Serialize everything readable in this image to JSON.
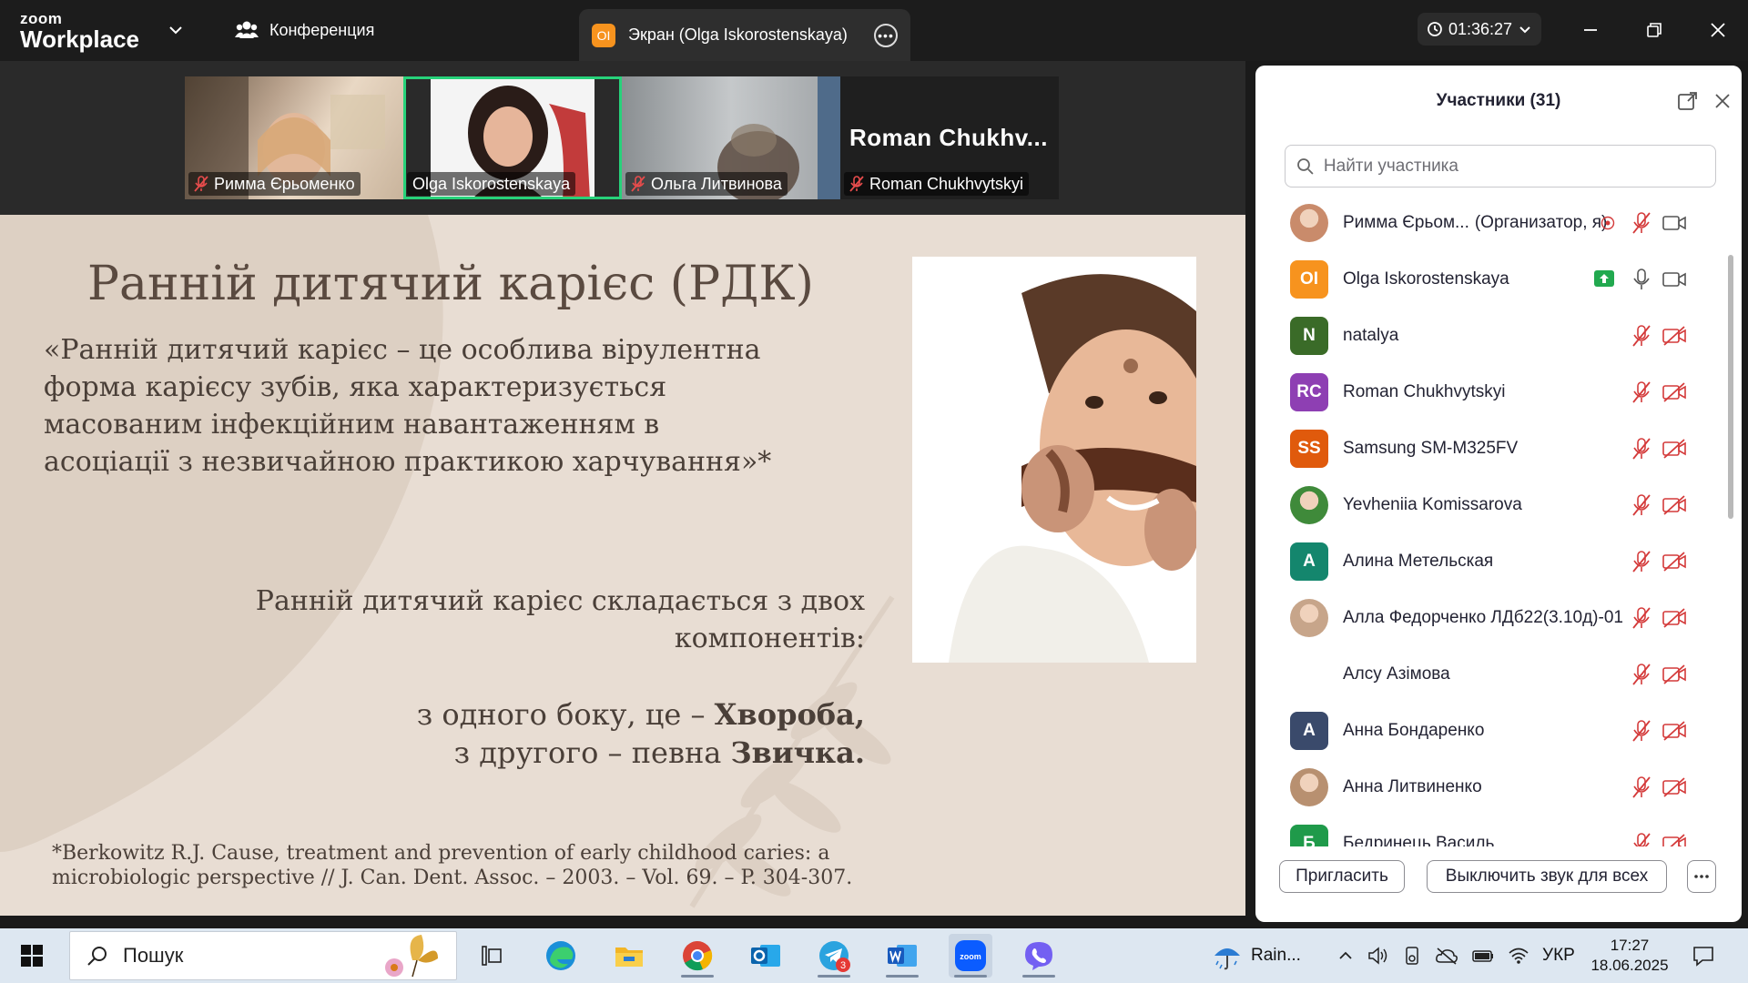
{
  "topbar": {
    "brand_small": "zoom",
    "brand_big": "Workplace",
    "conference_label": "Конференция",
    "screen_tab_badge": "OI",
    "screen_tab_label": "Экран (Olga Iskorostenskaya)",
    "timer": "01:36:27"
  },
  "video_strip": [
    {
      "name": "Римма Єрьоменко",
      "muted": true
    },
    {
      "name": "Olga Iskorostenskaya",
      "muted": false,
      "active": true
    },
    {
      "name": "Ольга Литвинова",
      "muted": true
    },
    {
      "name": "Roman Chukhvytskyi",
      "muted": true,
      "big_name": "Roman  Chukhv..."
    }
  ],
  "slide": {
    "title": "Ранній дитячий карієс (РДК)",
    "definition": "«Ранній дитячий карієс – це особлива вірулентна форма карієсу зубів, яка характеризується масованим інфекційним навантаженням в асоціації з незвичайною практикою харчування»*",
    "components": "Ранній дитячий карієс складається з двох компонентів:",
    "side1_prefix": "з одного боку, це – ",
    "side1_bold": "Хвороба,",
    "side2_prefix": "з другого – певна ",
    "side2_bold": "Звичка.",
    "reference": "*Berkowitz R.J. Cause, treatment and prevention of early childhood caries: a microbiologic perspective // J. Can. Dent. Assoc. – 2003. – Vol. 69. – P. 304-307."
  },
  "participants": {
    "title": "Участники (31)",
    "search_placeholder": "Найти участника",
    "list": [
      {
        "name": "Римма Єрьом...",
        "role": "(Организатор, я)",
        "avatar_type": "photo",
        "avatar_color": "#c98b6b",
        "mic": "muted",
        "video": "on",
        "extra": "record-icon"
      },
      {
        "name": "Olga Iskorostenskaya",
        "initials": "OI",
        "avatar_color": "#f7931e",
        "mic": "on",
        "video": "on",
        "extra": "share-icon"
      },
      {
        "name": "natalya",
        "initials": "N",
        "avatar_color": "#3a6b28",
        "mic": "muted",
        "video": "off"
      },
      {
        "name": "Roman Chukhvytskyi",
        "initials": "RC",
        "avatar_color": "#8e3fb3",
        "mic": "muted",
        "video": "off"
      },
      {
        "name": "Samsung SM-M325FV",
        "initials": "SS",
        "avatar_color": "#e05a0c",
        "mic": "muted",
        "video": "off"
      },
      {
        "name": "Yevheniia Komissarova",
        "avatar_type": "photo",
        "avatar_color": "#3f8a3a",
        "mic": "muted",
        "video": "off"
      },
      {
        "name": "Алина Метельская",
        "initials": "А",
        "avatar_color": "#14866d",
        "mic": "muted",
        "video": "off"
      },
      {
        "name": "Алла Федорченко ЛДб22(3.10д)-01",
        "avatar_type": "photo",
        "avatar_color": "#c7a58a",
        "mic": "muted",
        "video": "off"
      },
      {
        "name": "Алсу Азімова",
        "avatar_type": "none",
        "mic": "muted",
        "video": "off"
      },
      {
        "name": "Анна Бондаренко",
        "initials": "А",
        "avatar_color": "#3a4a6b",
        "mic": "muted",
        "video": "off"
      },
      {
        "name": "Анна Литвиненко",
        "avatar_type": "photo",
        "avatar_color": "#b89070",
        "mic": "muted",
        "video": "off"
      },
      {
        "name": "Бедринець Василь",
        "initials": "Б",
        "avatar_color": "#1f9a4a",
        "mic": "muted",
        "video": "off"
      }
    ],
    "invite_label": "Пригласить",
    "mute_all_label": "Выключить звук для всех"
  },
  "taskbar": {
    "search_label": "Пошук",
    "telegram_badge": "3",
    "weather": "Rain...",
    "language": "УКР",
    "time": "17:27",
    "date": "18.06.2025"
  },
  "colors": {
    "muted_red": "#d43a3a",
    "active_border": "#27d27a",
    "slide_bg": "#e8ddd3",
    "slide_text": "#4a3f38"
  }
}
